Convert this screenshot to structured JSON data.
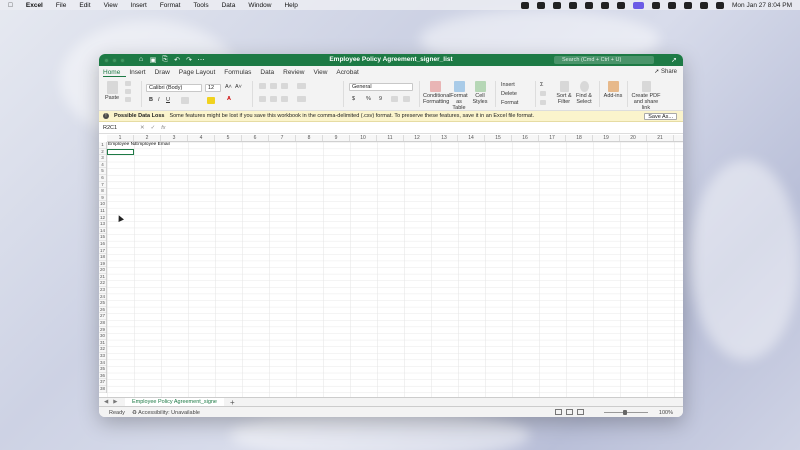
{
  "menubar": {
    "apple": "",
    "items": [
      "Excel",
      "File",
      "Edit",
      "View",
      "Insert",
      "Format",
      "Tools",
      "Data",
      "Window",
      "Help"
    ],
    "clock": "Mon Jan 27  8:04 PM"
  },
  "window": {
    "title": "Employee Policy Agreement_signer_list",
    "search_placeholder": "Search (Cmd + Ctrl + U)"
  },
  "tabs": [
    "Home",
    "Insert",
    "Draw",
    "Page Layout",
    "Formulas",
    "Data",
    "Review",
    "View",
    "Acrobat"
  ],
  "active_tab": "Home",
  "share_label": "Share",
  "ribbon": {
    "paste": "Paste",
    "font_name": "Calibri (Body)",
    "font_size": "12",
    "number_format": "General",
    "conditional_formatting": "Conditional Formatting",
    "format_as_table": "Format as Table",
    "cell_styles": "Cell Styles",
    "insert": "Insert",
    "delete": "Delete",
    "format": "Format",
    "sort_filter": "Sort & Filter",
    "find_select": "Find & Select",
    "add_ins": "Add-ins",
    "create_pdf": "Create PDF and share link"
  },
  "message": {
    "title": "Possible Data Loss",
    "text": "Some features might be lost if you save this workbook in the comma-delimited (.csv) format. To preserve these features, save it in an Excel file format.",
    "button": "Save As..."
  },
  "formula_bar": {
    "name_box": "R2C1",
    "fx": "fx"
  },
  "grid": {
    "columns": [
      "1",
      "2",
      "3",
      "4",
      "5",
      "6",
      "7",
      "8",
      "9",
      "10",
      "11",
      "12",
      "13",
      "14",
      "15",
      "16",
      "17",
      "18",
      "19",
      "20",
      "21"
    ],
    "rows": [
      "1",
      "2",
      "3",
      "4",
      "5",
      "6",
      "7",
      "8",
      "9",
      "10",
      "11",
      "12",
      "13",
      "14",
      "15",
      "16",
      "17",
      "18",
      "19",
      "20",
      "21",
      "22",
      "23",
      "24",
      "25",
      "26",
      "27",
      "28",
      "29",
      "30",
      "31",
      "32",
      "33",
      "34",
      "35",
      "36",
      "37",
      "38"
    ],
    "cell_r1c1": "Employee Na",
    "cell_r1c2": "Employee Email"
  },
  "sheet_tab": "Employee Policy Agreement_signe",
  "status": {
    "ready": "Ready",
    "accessibility": "Accessibility: Unavailable",
    "zoom": "100%"
  },
  "colors": {
    "excel_green": "#1d7a45",
    "message_bg": "#fbf4cc"
  }
}
